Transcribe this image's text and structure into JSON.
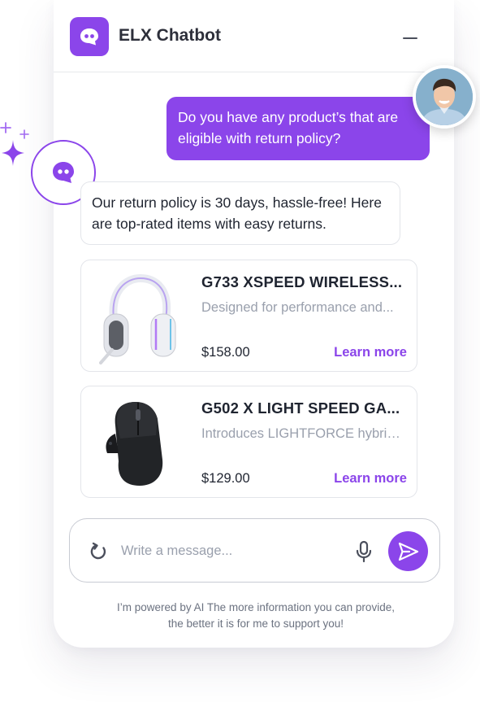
{
  "colors": {
    "accent": "#8b45ea",
    "accent_light": "#9b5cf0",
    "text_dark": "#1f2430",
    "text_muted": "#9aa0ad"
  },
  "header": {
    "title": "ELX Chatbot",
    "logo_icon": "chat-bubble-icon",
    "minimize_icon": "minimize-icon"
  },
  "messages": {
    "user": {
      "text": "Do you have any product’s that are eligible with return policy?"
    },
    "bot": {
      "text": "Our return policy is 30 days, hassle-free! Here are top-rated items with easy returns."
    }
  },
  "products": [
    {
      "name": "G733 XSPEED WIRELESS...",
      "description": "Designed for performance and...",
      "price": "$158.00",
      "link_label": "Learn more",
      "image_icon": "headset-image"
    },
    {
      "name": "G502 X LIGHT SPEED GA...",
      "description": "Introduces LIGHTFORCE hybrid...",
      "price": "$129.00",
      "link_label": "Learn more",
      "image_icon": "mouse-image"
    }
  ],
  "composer": {
    "placeholder": "Write a message...",
    "refresh_icon": "refresh-icon",
    "mic_icon": "microphone-icon",
    "send_icon": "send-icon"
  },
  "footer": {
    "line1": "I’m powered by AI The more information you can provide,",
    "line2": "the better it is for me to support you!"
  }
}
